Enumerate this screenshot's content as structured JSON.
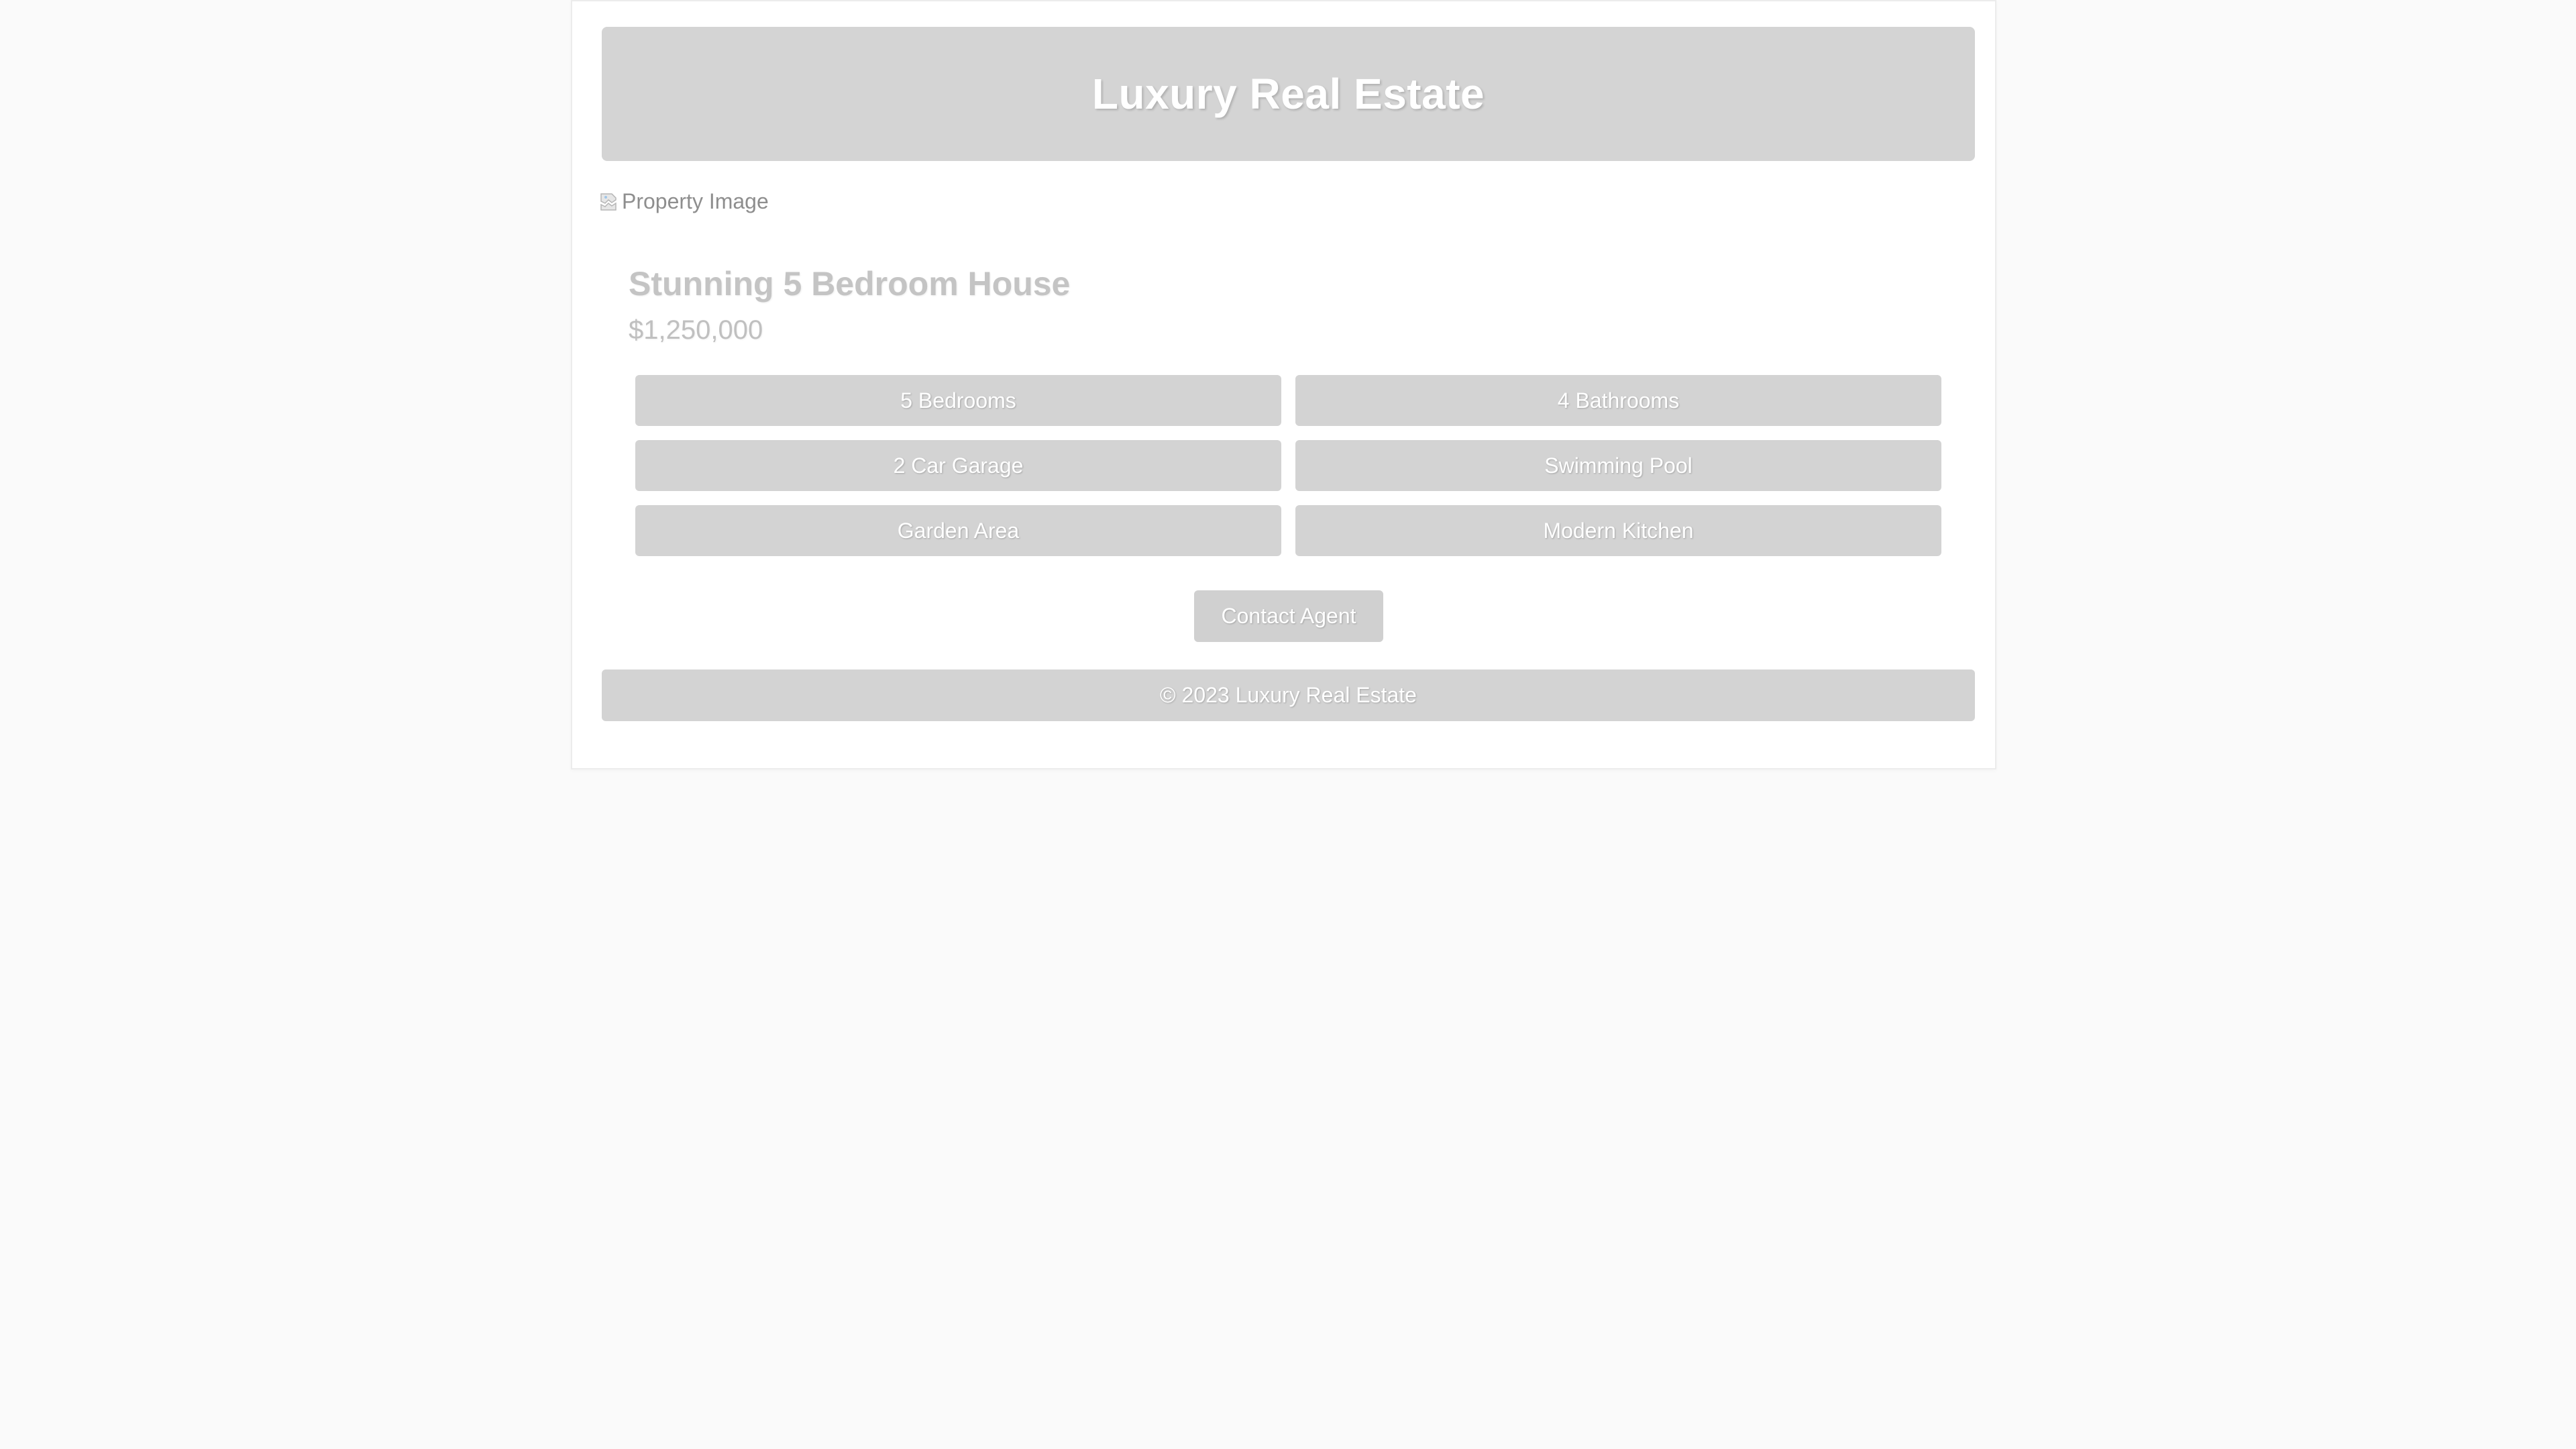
{
  "header": {
    "title": "Luxury Real Estate"
  },
  "property": {
    "image_alt": "Property Image",
    "image_icon": "broken-image-icon",
    "title": "Stunning 5 Bedroom House",
    "price": "$1,250,000",
    "features": [
      {
        "label": "5 Bedrooms"
      },
      {
        "label": "4 Bathrooms"
      },
      {
        "label": "2 Car Garage"
      },
      {
        "label": "Swimming Pool"
      },
      {
        "label": "Garden Area"
      },
      {
        "label": "Modern Kitchen"
      }
    ],
    "contact_label": "Contact Agent"
  },
  "footer": {
    "text": "© 2023 Luxury Real Estate"
  },
  "colors": {
    "page_background": "#fafafa",
    "card_background": "#ffffff",
    "block_gray": "#d3d3d3",
    "title_gray": "#c4c4c4"
  }
}
